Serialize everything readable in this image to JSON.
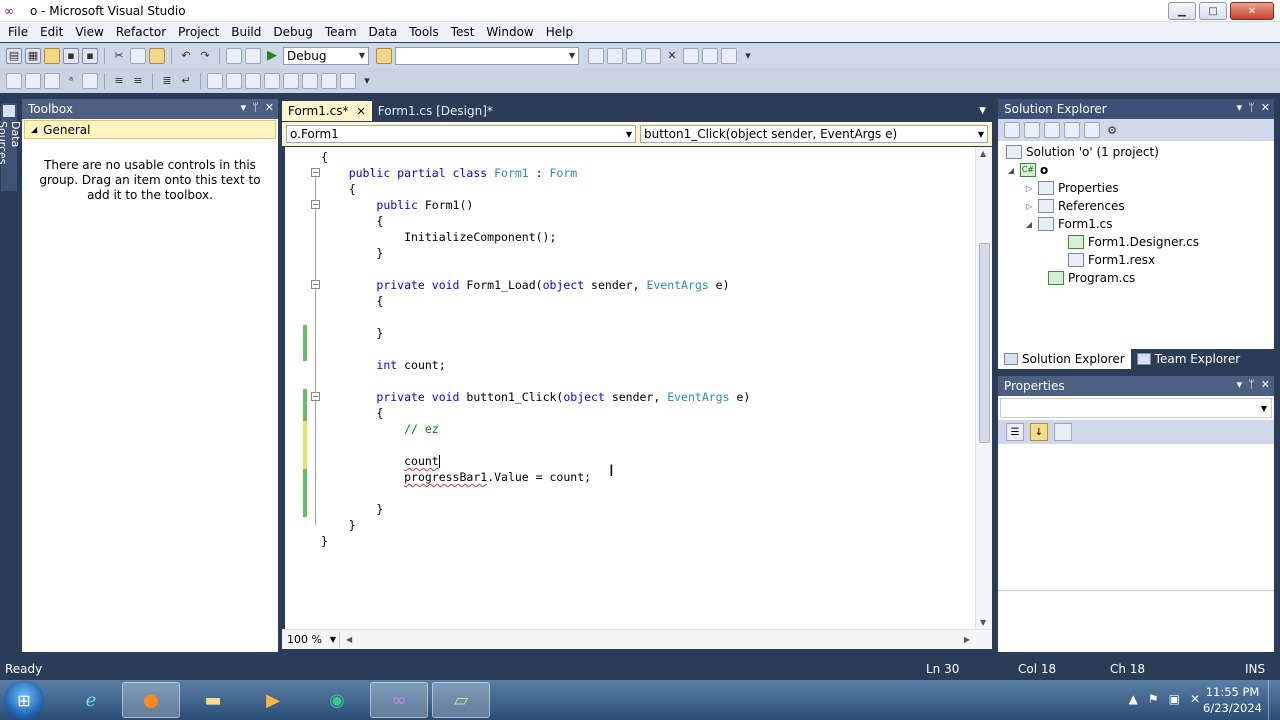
{
  "window": {
    "title": "o - Microsoft Visual Studio",
    "buttons": {
      "minimize": "▁",
      "maximize": "□",
      "close": "✕"
    }
  },
  "menu": [
    "File",
    "Edit",
    "View",
    "Refactor",
    "Project",
    "Build",
    "Debug",
    "Team",
    "Data",
    "Tools",
    "Test",
    "Window",
    "Help"
  ],
  "toolbar": {
    "config_value": "Debug",
    "platform_value": ""
  },
  "left_strip": {
    "data_sources_label": "Data Sources"
  },
  "toolbox": {
    "title": "Toolbox",
    "group": "General",
    "group_triangle": "◢",
    "empty_message": "There are no usable controls in this group. Drag an item onto this text to add it to the toolbox."
  },
  "panel_buttons": {
    "dropdown": "▾",
    "pin": "ᛘ",
    "close": "✕"
  },
  "editor": {
    "tabs": [
      {
        "label": "Form1.cs*",
        "close": "✕"
      },
      {
        "label": "Form1.cs [Design]*"
      }
    ],
    "nav_class": "o.Form1",
    "nav_member": "button1_Click(object sender, EventArgs e)",
    "zoom": "100 %",
    "lines": [
      {
        "segments": [
          {
            "text": "{"
          }
        ]
      },
      {
        "segments": [
          {
            "text": "    "
          },
          {
            "text": "public partial class ",
            "c": "kw"
          },
          {
            "text": "Form1",
            "c": "ty"
          },
          {
            "text": " : "
          },
          {
            "text": "Form",
            "c": "ty"
          }
        ]
      },
      {
        "segments": [
          {
            "text": "    {"
          }
        ]
      },
      {
        "segments": [
          {
            "text": "        "
          },
          {
            "text": "public ",
            "c": "kw"
          },
          {
            "text": "Form1()"
          }
        ]
      },
      {
        "segments": [
          {
            "text": "        {"
          }
        ]
      },
      {
        "segments": [
          {
            "text": "            InitializeComponent();"
          }
        ]
      },
      {
        "segments": [
          {
            "text": "        }"
          }
        ]
      },
      {
        "segments": [
          {
            "text": ""
          }
        ]
      },
      {
        "segments": [
          {
            "text": "        "
          },
          {
            "text": "private void ",
            "c": "kw"
          },
          {
            "text": "Form1_Load("
          },
          {
            "text": "object ",
            "c": "kw"
          },
          {
            "text": "sender, "
          },
          {
            "text": "EventArgs",
            "c": "ty"
          },
          {
            "text": " e)"
          }
        ]
      },
      {
        "segments": [
          {
            "text": "        {"
          }
        ]
      },
      {
        "segments": [
          {
            "text": ""
          }
        ]
      },
      {
        "segments": [
          {
            "text": "        }"
          }
        ]
      },
      {
        "segments": [
          {
            "text": ""
          }
        ]
      },
      {
        "segments": [
          {
            "text": "        "
          },
          {
            "text": "int ",
            "c": "kw"
          },
          {
            "text": "count;"
          }
        ]
      },
      {
        "segments": [
          {
            "text": ""
          }
        ]
      },
      {
        "segments": [
          {
            "text": "        "
          },
          {
            "text": "private void ",
            "c": "kw"
          },
          {
            "text": "button1_Click("
          },
          {
            "text": "object ",
            "c": "kw"
          },
          {
            "text": "sender, "
          },
          {
            "text": "EventArgs",
            "c": "ty"
          },
          {
            "text": " e)"
          }
        ]
      },
      {
        "segments": [
          {
            "text": "        {"
          }
        ]
      },
      {
        "segments": [
          {
            "text": "            "
          },
          {
            "text": "// ez",
            "c": "cm"
          }
        ]
      },
      {
        "segments": [
          {
            "text": ""
          }
        ]
      },
      {
        "segments": [
          {
            "text": "            "
          },
          {
            "text": "count",
            "c": "squig"
          }
        ],
        "caret": true
      },
      {
        "segments": [
          {
            "text": "            "
          },
          {
            "text": "progressBar1",
            "c": "squig"
          },
          {
            "text": ".Value = count;"
          }
        ]
      },
      {
        "segments": [
          {
            "text": ""
          }
        ]
      },
      {
        "segments": [
          {
            "text": "        }"
          }
        ]
      },
      {
        "segments": [
          {
            "text": "    }"
          }
        ]
      },
      {
        "segments": [
          {
            "text": "}"
          }
        ]
      }
    ]
  },
  "solution_explorer": {
    "title": "Solution Explorer",
    "nodes": [
      {
        "label": "Solution 'o' (1 project)",
        "tri": "",
        "icon": "SLN"
      },
      {
        "label": "o",
        "tri": "◢",
        "icon": "C#"
      },
      {
        "label": "Properties",
        "tri": "▷",
        "icon": ""
      },
      {
        "label": "References",
        "tri": "▷",
        "icon": ""
      },
      {
        "label": "Form1.cs",
        "tri": "◢",
        "icon": ""
      },
      {
        "label": "Form1.Designer.cs",
        "tri": "",
        "icon": "cs"
      },
      {
        "label": "Form1.resx",
        "tri": "",
        "icon": ""
      },
      {
        "label": "Program.cs",
        "tri": "",
        "icon": "cs"
      }
    ],
    "tabs": [
      "Solution Explorer",
      "Team Explorer"
    ]
  },
  "properties": {
    "title": "Properties"
  },
  "status": {
    "message": "Ready",
    "ln": "Ln 30",
    "col": "Col 18",
    "ch": "Ch 18",
    "mode": "INS"
  },
  "taskbar": {
    "time": "11:55 PM",
    "date": "6/23/2024"
  }
}
